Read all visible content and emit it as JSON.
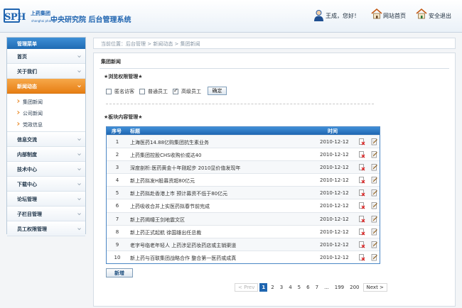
{
  "header": {
    "logo_mark": "SPH",
    "logo_cn": "上药集团",
    "logo_en": "shanghai pharma",
    "system_title": "中央研究院  后台管理系统",
    "user_greeting": "王成，您好！",
    "site_home": "网站首页",
    "logout": "安全退出"
  },
  "sidebar": {
    "title": "管理菜单",
    "items_before": [
      {
        "label": "首页"
      },
      {
        "label": "关于我们"
      }
    ],
    "active": {
      "label": "新闻动态"
    },
    "subitems": [
      {
        "label": "集团新闻"
      },
      {
        "label": "公司新闻"
      },
      {
        "label": "党政信息"
      }
    ],
    "items_after": [
      {
        "label": "信息交流"
      },
      {
        "label": "内部制度"
      },
      {
        "label": "技术中心"
      },
      {
        "label": "下载中心"
      },
      {
        "label": "论坛管理"
      },
      {
        "label": "子栏目管理"
      },
      {
        "label": "员工权限管理"
      }
    ]
  },
  "breadcrumb": "当前位置：后台管理 > 新闻动态 > 集团新闻",
  "panel": {
    "title": "集团新闻",
    "perm_title": "★浏览权限管理★",
    "perm_options": [
      {
        "label": "匿名访客",
        "checked": false
      },
      {
        "label": "普通员工",
        "checked": false
      },
      {
        "label": "高级员工",
        "checked": true
      }
    ],
    "confirm": "确定",
    "blocks_title": "★板块内容管理★",
    "table": {
      "headers": {
        "no": "序号",
        "title": "标题",
        "time": "时间"
      },
      "rows": [
        {
          "no": "1",
          "title": "上海医药14.88亿购集团抗生素业务",
          "time": "2010-12-12"
        },
        {
          "no": "2",
          "title": "上药集团控股CHS收购价或达40",
          "time": "2010-12-12"
        },
        {
          "no": "3",
          "title": "深度剖析:医药黄金十年刚起步 2010显价值发现年",
          "time": "2010-12-12"
        },
        {
          "no": "4",
          "title": "新上药拟发H股募资超80亿元",
          "time": "2010-12-12"
        },
        {
          "no": "5",
          "title": "新上药拟赴香港上市 预计募资不低于80亿元",
          "time": "2010-12-12"
        },
        {
          "no": "6",
          "title": "上药吸收合并上实医药拟春节前完成",
          "time": "2010-12-12"
        },
        {
          "no": "7",
          "title": "新上药揭幢王剑地震文区",
          "time": "2010-12-12"
        },
        {
          "no": "8",
          "title": "新上药正式起航 徐国雄出任总裁",
          "time": "2010-12-12"
        },
        {
          "no": "9",
          "title": "老字号临老年轻人 上药涉足药妆药店或主销渠道",
          "time": "2010-12-12"
        },
        {
          "no": "10",
          "title": "新上药与百联集团战略合作 整合第一医药或成真",
          "time": "2010-12-12"
        }
      ]
    },
    "add_button": "新增",
    "pager": {
      "prev": "< Prev",
      "pages": [
        "1",
        "2",
        "3",
        "4",
        "5",
        "6",
        "7"
      ],
      "dots": "...",
      "tail": [
        "199",
        "200"
      ],
      "next": "Next >",
      "current": "1"
    }
  },
  "colors": {
    "brand_blue": "#1f64b0",
    "active_orange": "#e77f14",
    "table_header": "#1e65b0"
  },
  "icons": {
    "user": "user-avatar-icon",
    "site_home": "house-icon",
    "logout": "house-exit-icon",
    "delete": "delete-doc-icon",
    "edit": "edit-doc-icon"
  }
}
